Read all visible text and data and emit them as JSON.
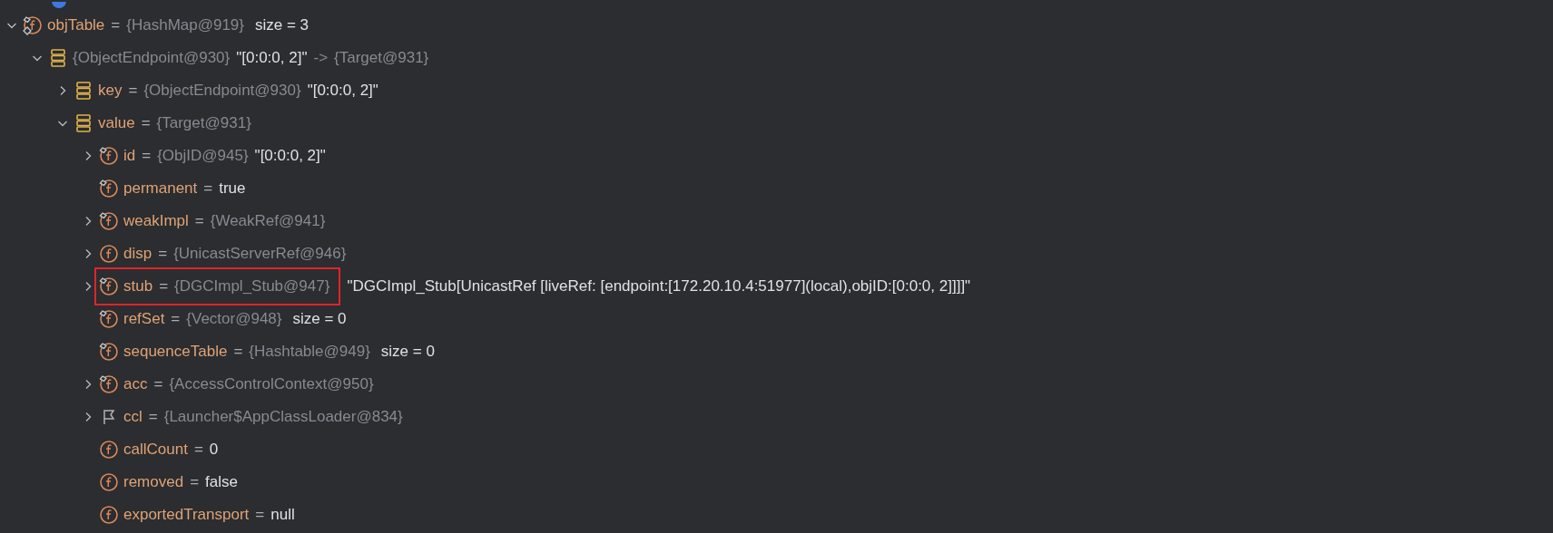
{
  "tree": [
    {
      "kind": "static-final-field",
      "expanded": true,
      "segments": [
        {
          "kind": "name",
          "text": "objTable"
        },
        {
          "kind": "equals",
          "text": "="
        },
        {
          "kind": "type",
          "text": "{HashMap@919}"
        },
        {
          "kind": "size",
          "text": "size = 3"
        }
      ],
      "children": [
        {
          "kind": "entry",
          "expanded": true,
          "segments": [
            {
              "kind": "type",
              "text": "{ObjectEndpoint@930}"
            },
            {
              "kind": "value",
              "text": "\"[0:0:0, 2]\""
            },
            {
              "kind": "type",
              "text": "->"
            },
            {
              "kind": "type",
              "text": "{Target@931}"
            }
          ],
          "children": [
            {
              "kind": "entry",
              "expanded": false,
              "segments": [
                {
                  "kind": "name",
                  "text": "key"
                },
                {
                  "kind": "equals",
                  "text": "="
                },
                {
                  "kind": "type",
                  "text": "{ObjectEndpoint@930}"
                },
                {
                  "kind": "value",
                  "text": "\"[0:0:0, 2]\""
                }
              ]
            },
            {
              "kind": "entry",
              "expanded": true,
              "segments": [
                {
                  "kind": "name",
                  "text": "value"
                },
                {
                  "kind": "equals",
                  "text": "="
                },
                {
                  "kind": "type",
                  "text": "{Target@931}"
                }
              ],
              "children": [
                {
                  "kind": "final-field",
                  "expanded": false,
                  "segments": [
                    {
                      "kind": "name",
                      "text": "id"
                    },
                    {
                      "kind": "equals",
                      "text": "="
                    },
                    {
                      "kind": "type",
                      "text": "{ObjID@945}"
                    },
                    {
                      "kind": "value",
                      "text": "\"[0:0:0, 2]\""
                    }
                  ]
                },
                {
                  "kind": "final-field",
                  "segments": [
                    {
                      "kind": "name",
                      "text": "permanent"
                    },
                    {
                      "kind": "equals",
                      "text": "="
                    },
                    {
                      "kind": "value",
                      "text": "true"
                    }
                  ]
                },
                {
                  "kind": "final-field",
                  "expanded": false,
                  "segments": [
                    {
                      "kind": "name",
                      "text": "weakImpl"
                    },
                    {
                      "kind": "equals",
                      "text": "="
                    },
                    {
                      "kind": "type",
                      "text": "{WeakRef@941}"
                    }
                  ]
                },
                {
                  "kind": "field",
                  "expanded": false,
                  "segments": [
                    {
                      "kind": "name",
                      "text": "disp"
                    },
                    {
                      "kind": "equals",
                      "text": "="
                    },
                    {
                      "kind": "type",
                      "text": "{UnicastServerRef@946}"
                    }
                  ]
                },
                {
                  "kind": "final-field",
                  "expanded": false,
                  "highlighted": true,
                  "segments": [
                    {
                      "kind": "name",
                      "text": "stub"
                    },
                    {
                      "kind": "equals",
                      "text": "="
                    },
                    {
                      "kind": "type",
                      "text": "{DGCImpl_Stub@947}"
                    },
                    {
                      "kind": "value",
                      "text": "\"DGCImpl_Stub[UnicastRef [liveRef: [endpoint:[172.20.10.4:51977](local),objID:[0:0:0, 2]]]]\""
                    }
                  ]
                },
                {
                  "kind": "final-field",
                  "segments": [
                    {
                      "kind": "name",
                      "text": "refSet"
                    },
                    {
                      "kind": "equals",
                      "text": "="
                    },
                    {
                      "kind": "type",
                      "text": "{Vector@948}"
                    },
                    {
                      "kind": "size",
                      "text": "size = 0"
                    }
                  ]
                },
                {
                  "kind": "final-field",
                  "segments": [
                    {
                      "kind": "name",
                      "text": "sequenceTable"
                    },
                    {
                      "kind": "equals",
                      "text": "="
                    },
                    {
                      "kind": "type",
                      "text": "{Hashtable@949}"
                    },
                    {
                      "kind": "size",
                      "text": "size = 0"
                    }
                  ]
                },
                {
                  "kind": "final-field",
                  "expanded": false,
                  "segments": [
                    {
                      "kind": "name",
                      "text": "acc"
                    },
                    {
                      "kind": "equals",
                      "text": "="
                    },
                    {
                      "kind": "type",
                      "text": "{AccessControlContext@950}"
                    }
                  ]
                },
                {
                  "kind": "flag",
                  "expanded": false,
                  "segments": [
                    {
                      "kind": "name",
                      "text": "ccl"
                    },
                    {
                      "kind": "equals",
                      "text": "="
                    },
                    {
                      "kind": "type",
                      "text": "{Launcher$AppClassLoader@834}"
                    }
                  ]
                },
                {
                  "kind": "field",
                  "segments": [
                    {
                      "kind": "name",
                      "text": "callCount"
                    },
                    {
                      "kind": "equals",
                      "text": "="
                    },
                    {
                      "kind": "value",
                      "text": "0"
                    }
                  ]
                },
                {
                  "kind": "field",
                  "segments": [
                    {
                      "kind": "name",
                      "text": "removed"
                    },
                    {
                      "kind": "equals",
                      "text": "="
                    },
                    {
                      "kind": "value",
                      "text": "false"
                    }
                  ]
                },
                {
                  "kind": "field",
                  "segments": [
                    {
                      "kind": "name",
                      "text": "exportedTransport"
                    },
                    {
                      "kind": "equals",
                      "text": "="
                    },
                    {
                      "kind": "value",
                      "text": "null"
                    }
                  ]
                }
              ]
            }
          ]
        }
      ]
    }
  ]
}
